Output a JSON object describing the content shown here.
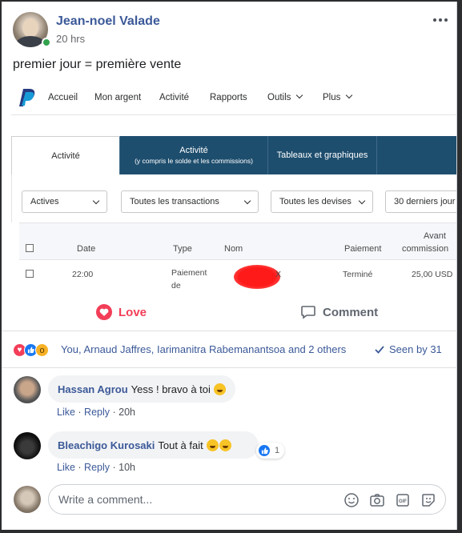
{
  "post": {
    "author": "Jean-noel Valade",
    "time": "20 hrs",
    "text": "premier jour = première vente"
  },
  "paypal": {
    "nav": [
      "Accueil",
      "Mon argent",
      "Activité",
      "Rapports",
      "Outils",
      "Plus"
    ],
    "tabs": [
      {
        "label": "Activité",
        "sub": ""
      },
      {
        "label": "Activité",
        "sub": "(y compris le solde et les commissions)"
      },
      {
        "label": "Tableaux et graphiques",
        "sub": ""
      }
    ],
    "filters": [
      "Actives",
      "Toutes les transactions",
      "Toutes les devises",
      "30 derniers jour"
    ],
    "columns": {
      "date": "Date",
      "type": "Type",
      "nom": "Nom",
      "paiement": "Paiement",
      "avant_line1": "Avant",
      "avant_line2": "commission"
    },
    "row": {
      "date": "22:00",
      "type_line1": "Paiement",
      "type_line2": "de",
      "nom_tail": "X",
      "paiement": "Terminé",
      "amount": "25,00 USD"
    }
  },
  "actions": {
    "love_label": "Love",
    "comment_label": "Comment"
  },
  "summary": {
    "text": "You, Arnaud Jaffres, Iarimanitra Rabemanantsoa and 2 others",
    "seen_by": "Seen by 31"
  },
  "comments": [
    {
      "name": "Hassan Agrou",
      "text": "Yess ! bravo à toi",
      "like": "Like",
      "reply": "Reply",
      "time": "20h"
    },
    {
      "name": "Bleachigo Kurosaki",
      "text": "Tout à fait",
      "like": "Like",
      "reply": "Reply",
      "time": "10h",
      "like_count": "1"
    }
  ],
  "composer": {
    "placeholder": "Write a comment..."
  },
  "colors": {
    "link": "#3b5998",
    "love": "#f33e58",
    "like": "#1877f2",
    "paypal_tab": "#1e4e6e"
  }
}
